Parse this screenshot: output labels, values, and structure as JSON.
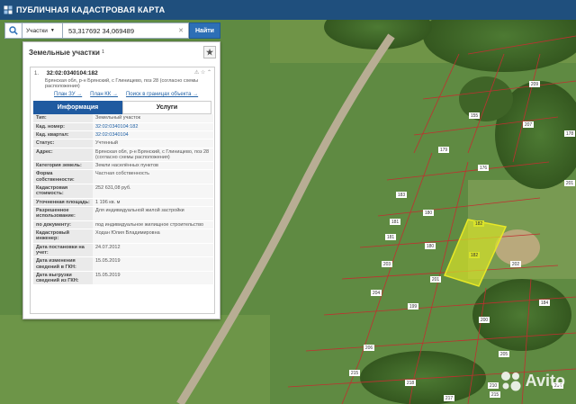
{
  "header": {
    "title": "ПУБЛИЧНАЯ КАДАСТРОВАЯ КАРТА"
  },
  "search": {
    "type": "Участки",
    "value": "53,317692 34,069489",
    "clear": "✕",
    "find": "Найти"
  },
  "panel": {
    "title": "Земельные участки",
    "count": "1",
    "star": "★",
    "item": {
      "index": "1.",
      "cadastral": "32:02:0340104:182",
      "address": "Брянская обл, р-н Брянский, с Глинищево, поз 28 (согласно схемы расположения)",
      "tools": "⚠ ☆ ⌃",
      "links": [
        "План ЗУ →",
        "План КК →",
        "Поиск в границах объекта →"
      ],
      "tabs": [
        "Информация",
        "Услуги"
      ],
      "rows": [
        {
          "k": "Тип:",
          "v": "Земельный участок"
        },
        {
          "k": "Кад. номер:",
          "v": "32:02:0340104:182"
        },
        {
          "k": "Кад. квартал:",
          "v": "32:02:0340104"
        },
        {
          "k": "Статус:",
          "v": "Учтенный"
        },
        {
          "k": "Адрес:",
          "v": "Брянская обл, р-н Брянский, с Глинищево, поз 28 (согласно схемы расположения)"
        },
        {
          "k": "Категория земель:",
          "v": "Земли населённых пунктов"
        },
        {
          "k": "Форма собственности:",
          "v": "Частная собственность"
        },
        {
          "k": "Кадастровая стоимость:",
          "v": "252 631,08 руб."
        },
        {
          "k": "Уточненная площадь:",
          "v": "1 196 кв. м"
        },
        {
          "k": "Разрешенное использование:",
          "v": "Для индивидуальной жилой застройки"
        },
        {
          "k": "по документу:",
          "v": "под индивидуальное жилищное строительство"
        },
        {
          "k": "Кадастровый инженер:",
          "v": "Ходан Юлия Владимировна"
        },
        {
          "k": "Дата постановки на учет:",
          "v": "24.07.2012"
        },
        {
          "k": "Дата изменения сведений в ГКН:",
          "v": "15.05.2019"
        },
        {
          "k": "Дата выгрузки сведений из ГКН:",
          "v": "15.05.2019"
        }
      ]
    }
  },
  "map": {
    "highlight_label": "182",
    "top_label": "182",
    "plot_labels": [
      "209",
      "155",
      "207",
      "179",
      "176",
      "178",
      "180",
      "181",
      "181",
      "180",
      "183",
      "202",
      "201",
      "200",
      "199",
      "204",
      "203",
      "184",
      "201",
      "206",
      "205",
      "215",
      "218",
      "217",
      "215",
      "210",
      "214"
    ]
  },
  "watermark": {
    "text": "Avito"
  },
  "colors": {
    "header": "#1f4f7d",
    "accent": "#2d6fb6",
    "highlight": "#e5e52a",
    "boundary": "#c03030"
  }
}
